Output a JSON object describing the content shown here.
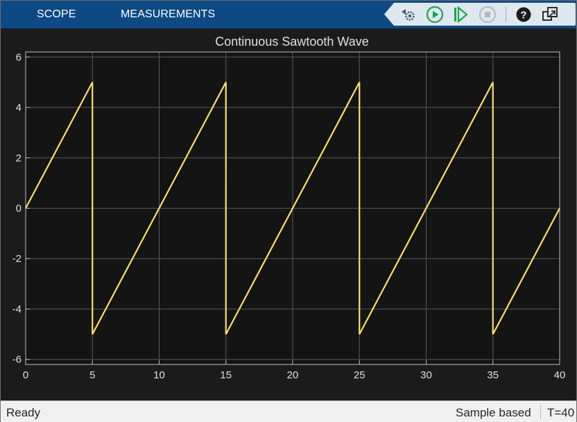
{
  "toolstrip": {
    "tabs": [
      {
        "label": "SCOPE"
      },
      {
        "label": "MEASUREMENTS"
      }
    ],
    "buttons": [
      {
        "name": "settings-icon"
      },
      {
        "name": "run-icon"
      },
      {
        "name": "step-forward-icon"
      },
      {
        "name": "stop-icon"
      },
      {
        "name": "help-icon"
      },
      {
        "name": "undock-icon"
      }
    ]
  },
  "colors": {
    "toolstrip_bg": "#0d4a83",
    "plot_bg": "#141414",
    "grid": "#5a5a5a",
    "signal": "#ffe066",
    "axis_text": "#e0e0e0"
  },
  "chart_data": {
    "type": "line",
    "title": "Continuous Sawtooth Wave",
    "xlabel": "",
    "ylabel": "",
    "xlim": [
      0,
      40
    ],
    "ylim": [
      -6.2,
      6.2
    ],
    "xticks": [
      0,
      5,
      10,
      15,
      20,
      25,
      30,
      35,
      40
    ],
    "yticks": [
      -6,
      -4,
      -2,
      0,
      2,
      4,
      6
    ],
    "grid": true,
    "series": [
      {
        "x": [
          0,
          5,
          5,
          15,
          15,
          25,
          25,
          35,
          35,
          40
        ],
        "y": [
          0,
          5,
          -5,
          5,
          -5,
          5,
          -5,
          5,
          -5,
          0
        ]
      }
    ]
  },
  "status": {
    "left": "Ready",
    "mode": "Sample based",
    "time": "T=40"
  }
}
